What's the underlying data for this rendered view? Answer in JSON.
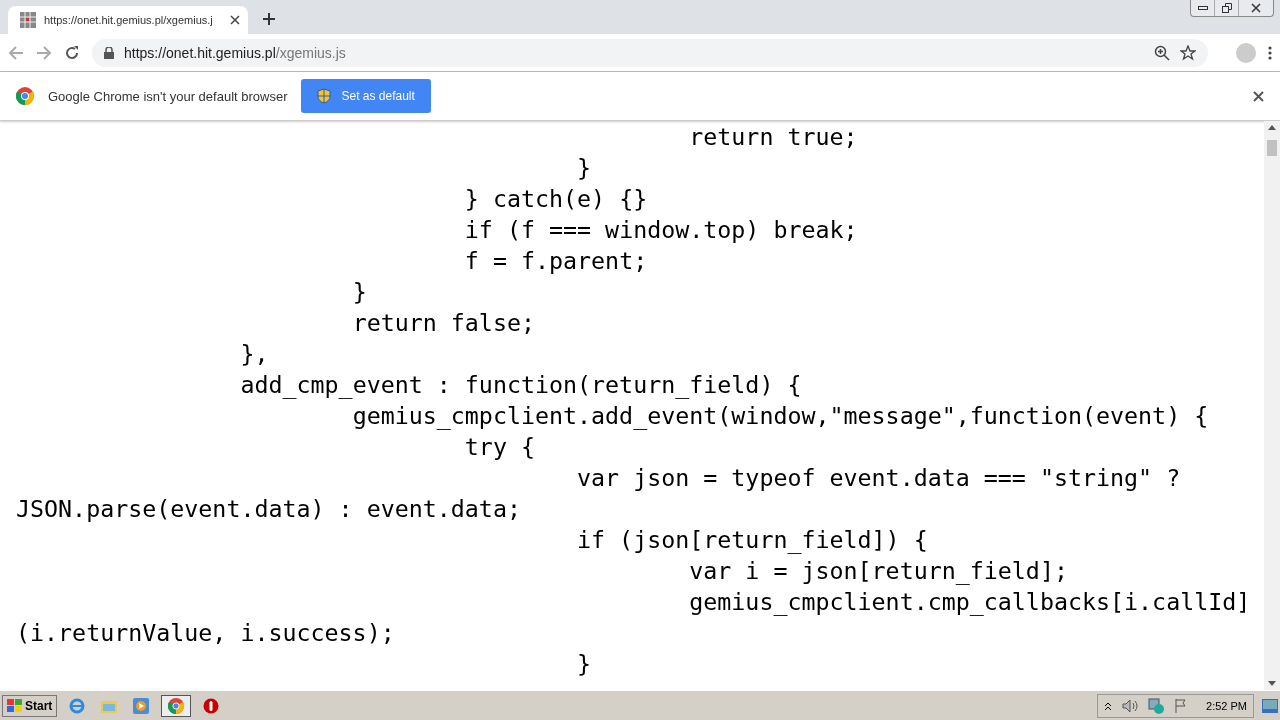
{
  "tab": {
    "title": "https://onet.hit.gemius.pl/xgemius.j",
    "selected": true
  },
  "address": {
    "host": "https://onet.hit.gemius.pl",
    "path": "/xgemius.js"
  },
  "infobar": {
    "message": "Google Chrome isn't your default browser",
    "button": "Set as default"
  },
  "code_lines": [
    "\t\t\t\t\t\treturn true;",
    "\t\t\t\t\t}",
    "\t\t\t\t} catch(e) {}",
    "\t\t\t\tif (f === window.top) break;",
    "\t\t\t\tf = f.parent;",
    "\t\t\t}",
    "\t\t\treturn false;",
    "\t\t},",
    "\t\tadd_cmp_event : function(return_field) {",
    "\t\t\tgemius_cmpclient.add_event(window,\"message\",function(event) {",
    "\t\t\t\ttry {",
    "\t\t\t\t\tvar json = typeof event.data === \"string\" ? JSON.parse(event.data) : event.data;",
    "\t\t\t\t\tif (json[return_field]) {",
    "\t\t\t\t\t\tvar i = json[return_field];",
    "\t\t\t\t\t\tgemius_cmpclient.cmp_callbacks[i.callId] (i.returnValue, i.success);",
    "\t\t\t\t\t}"
  ],
  "taskbar": {
    "start": "Start",
    "clock": "2:52 PM"
  }
}
